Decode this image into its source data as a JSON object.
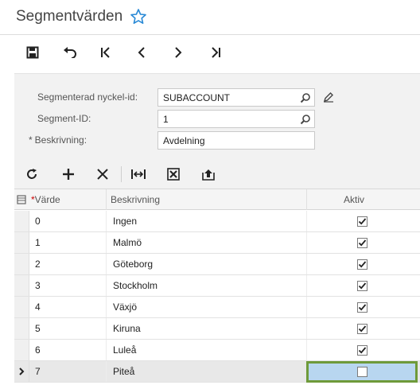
{
  "page": {
    "title": "Segmentvärden"
  },
  "form": {
    "segmented_key_label": "Segmenterad nyckel-id:",
    "segmented_key_value": "SUBACCOUNT",
    "segment_id_label": "Segment-ID:",
    "segment_id_value": "1",
    "description_req": "*",
    "description_label": "Beskrivning:",
    "description_value": "Avdelning"
  },
  "grid": {
    "columns": {
      "value_req": "*",
      "value": "Värde",
      "description": "Beskrivning",
      "active": "Aktiv"
    },
    "rows": [
      {
        "value": "0",
        "description": "Ingen",
        "active": true
      },
      {
        "value": "1",
        "description": "Malmö",
        "active": true
      },
      {
        "value": "2",
        "description": "Göteborg",
        "active": true
      },
      {
        "value": "3",
        "description": "Stockholm",
        "active": true
      },
      {
        "value": "4",
        "description": "Växjö",
        "active": true
      },
      {
        "value": "5",
        "description": "Kiruna",
        "active": true
      },
      {
        "value": "6",
        "description": "Luleå",
        "active": true
      },
      {
        "value": "7",
        "description": "Piteå",
        "active": false
      }
    ]
  },
  "colors": {
    "accent": "#1e90ff",
    "selection": "#b8d6f0",
    "selection_border": "#6e9a3a"
  }
}
